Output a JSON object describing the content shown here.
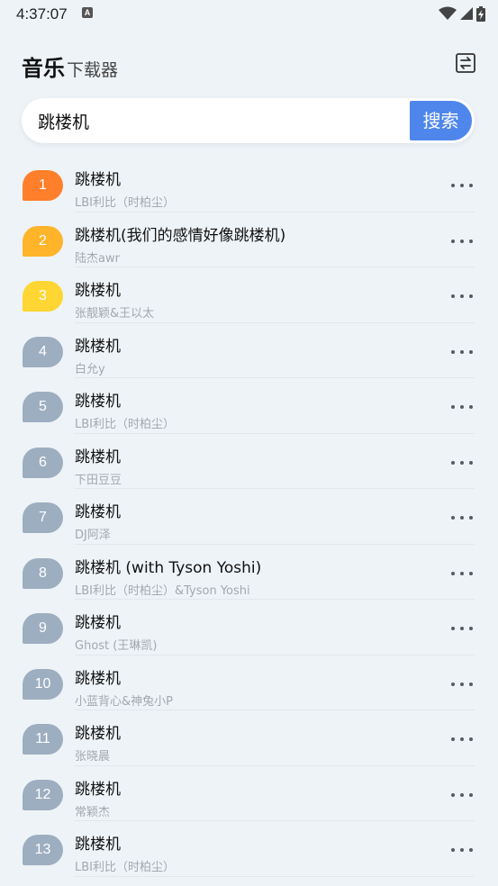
{
  "status_bar": {
    "time": "4:37:07",
    "notification_icon": "a-icon",
    "icons": [
      "wifi-icon",
      "signal-icon",
      "battery-charging-icon"
    ]
  },
  "header": {
    "title_main": "音乐",
    "title_sub": "下载器",
    "switch_icon": "switch-icon"
  },
  "search": {
    "value": "跳楼机",
    "button_label": "搜索"
  },
  "colors": {
    "accent": "#4f86ec",
    "rank_1": "#ff7f2a",
    "rank_2": "#ffb42a",
    "rank_3": "#ffd633",
    "rank_default": "#9eaec1"
  },
  "songs": [
    {
      "rank": "1",
      "title": "跳楼机",
      "artist": "LBI利比（时柏尘）"
    },
    {
      "rank": "2",
      "title": "跳楼机(我们的感情好像跳楼机)",
      "artist": "陆杰awr"
    },
    {
      "rank": "3",
      "title": "跳楼机",
      "artist": "张靓颖&王以太"
    },
    {
      "rank": "4",
      "title": "跳楼机",
      "artist": "白允y"
    },
    {
      "rank": "5",
      "title": "跳楼机",
      "artist": "LBI利比（时柏尘）"
    },
    {
      "rank": "6",
      "title": "跳楼机",
      "artist": "下田豆豆"
    },
    {
      "rank": "7",
      "title": "跳楼机",
      "artist": "DJ阿泽"
    },
    {
      "rank": "8",
      "title": "跳楼机 (with Tyson Yoshi)",
      "artist": "LBI利比（时柏尘）&Tyson Yoshi"
    },
    {
      "rank": "9",
      "title": "跳楼机",
      "artist": "Ghost (王琳凯)"
    },
    {
      "rank": "10",
      "title": "跳楼机",
      "artist": "小蓝背心&神兔小P"
    },
    {
      "rank": "11",
      "title": "跳楼机",
      "artist": "张晓晨"
    },
    {
      "rank": "12",
      "title": "跳楼机",
      "artist": "常颖杰"
    },
    {
      "rank": "13",
      "title": "跳楼机",
      "artist": "LBI利比（时柏尘）"
    }
  ]
}
